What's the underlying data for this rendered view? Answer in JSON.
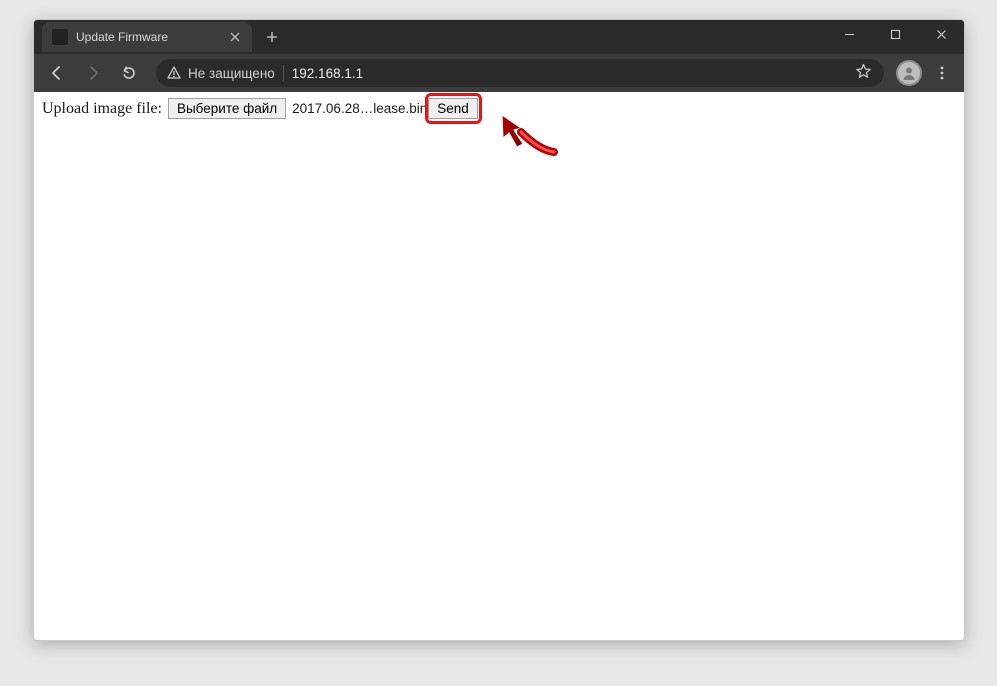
{
  "tab": {
    "title": "Update Firmware"
  },
  "toolbar": {
    "not_secure_label": "Не защищено",
    "url": "192.168.1.1"
  },
  "page": {
    "upload_label": "Upload image file:",
    "choose_file_label": "Выберите файл",
    "selected_file": "2017.06.28…lease.bin",
    "send_label": "Send"
  }
}
